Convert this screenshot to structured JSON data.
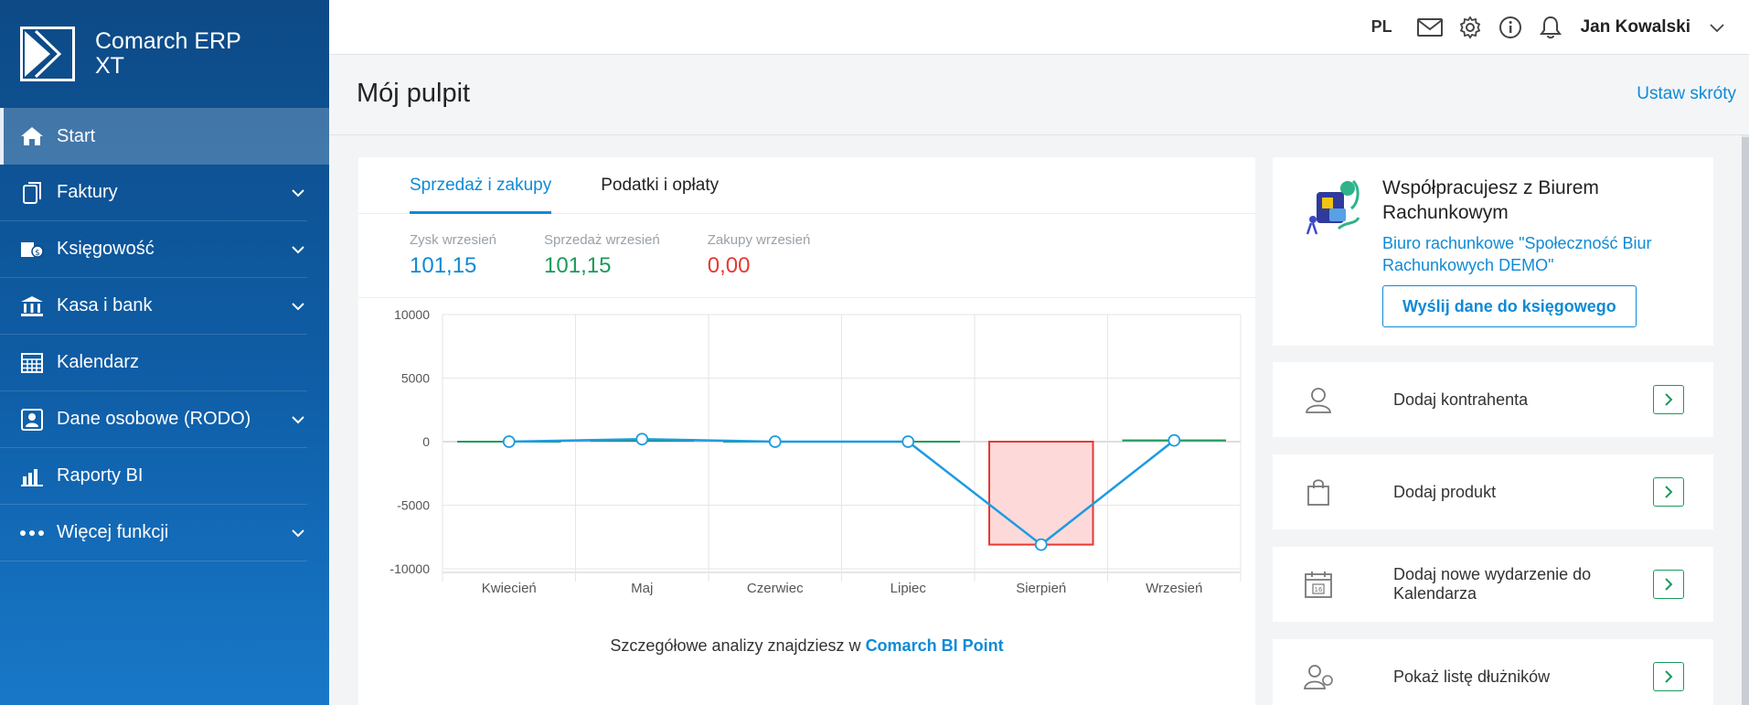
{
  "app": {
    "name_line1": "Comarch ERP",
    "name_line2": "XT"
  },
  "sidebar": {
    "items": [
      {
        "label": "Start",
        "icon": "home-icon",
        "has_chevron": false,
        "active": true
      },
      {
        "label": "Faktury",
        "icon": "invoice-icon",
        "has_chevron": true
      },
      {
        "label": "Księgowość",
        "icon": "accounting-icon",
        "has_chevron": true
      },
      {
        "label": "Kasa i bank",
        "icon": "bank-icon",
        "has_chevron": true
      },
      {
        "label": "Kalendarz",
        "icon": "calendar-icon",
        "has_chevron": false
      },
      {
        "label": "Dane osobowe (RODO)",
        "icon": "person-card-icon",
        "has_chevron": true
      },
      {
        "label": "Raporty BI",
        "icon": "bar-chart-icon",
        "has_chevron": false
      },
      {
        "label": "Więcej funkcji",
        "icon": "more-dots-icon",
        "has_chevron": true
      }
    ]
  },
  "topbar": {
    "language": "PL",
    "user": "Jan Kowalski",
    "icons": [
      "mail-icon",
      "gear-icon",
      "info-icon",
      "bell-icon",
      "chevron-down-icon"
    ]
  },
  "page": {
    "title": "Mój pulpit",
    "shortcuts_link": "Ustaw skróty"
  },
  "dashboard": {
    "tabs": [
      {
        "label": "Sprzedaż i zakupy",
        "active": true
      },
      {
        "label": "Podatki i opłaty",
        "active": false
      }
    ],
    "kpis": [
      {
        "label": "Zysk wrzesień",
        "value": "101,15",
        "color": "#0f8ad6"
      },
      {
        "label": "Sprzedaż wrzesień",
        "value": "101,15",
        "color": "#1a9a5a"
      },
      {
        "label": "Zakupy wrzesień",
        "value": "0,00",
        "color": "#e53935"
      }
    ],
    "footer_text": "Szczegółowe analizy znajdziesz w ",
    "footer_link": "Comarch BI Point"
  },
  "chart_data": {
    "type": "bar",
    "categories": [
      "Kwiecień",
      "Maj",
      "Czerwiec",
      "Lipiec",
      "Sierpień",
      "Wrzesień"
    ],
    "series": [
      {
        "type": "bar",
        "values": [
          0,
          200,
          0,
          0,
          0,
          101.15
        ],
        "color": "#1a9a5a"
      },
      {
        "type": "bar",
        "values": [
          0,
          0,
          0,
          0,
          -8100,
          0
        ],
        "color": "#e53935"
      },
      {
        "type": "line",
        "values": [
          0,
          200,
          0,
          0,
          -8100,
          101.15
        ],
        "color": "#1e9be0"
      }
    ],
    "yticks": [
      10000,
      5000,
      0,
      -5000,
      -10000
    ],
    "ylim": [
      -10000,
      10000
    ],
    "grid": true,
    "colors": {
      "positive": "#1a9a5a",
      "negative_fill": "#fdd9da",
      "negative_stroke": "#e53935",
      "line": "#1e9be0"
    }
  },
  "office": {
    "title": "Współpracujesz z Biurem Rachunkowym",
    "subtitle": "Biuro rachunkowe \"Społeczność Biur Rachunkowych DEMO\"",
    "button": "Wyślij dane do księgowego"
  },
  "actions": [
    {
      "label": "Dodaj kontrahenta",
      "icon": "person-icon"
    },
    {
      "label": "Dodaj produkt",
      "icon": "shopping-bag-icon"
    },
    {
      "label": "Dodaj nowe wydarzenie do Kalendarza",
      "icon": "calendar-event-icon"
    },
    {
      "label": "Pokaż listę dłużników",
      "icon": "debtors-icon"
    }
  ]
}
